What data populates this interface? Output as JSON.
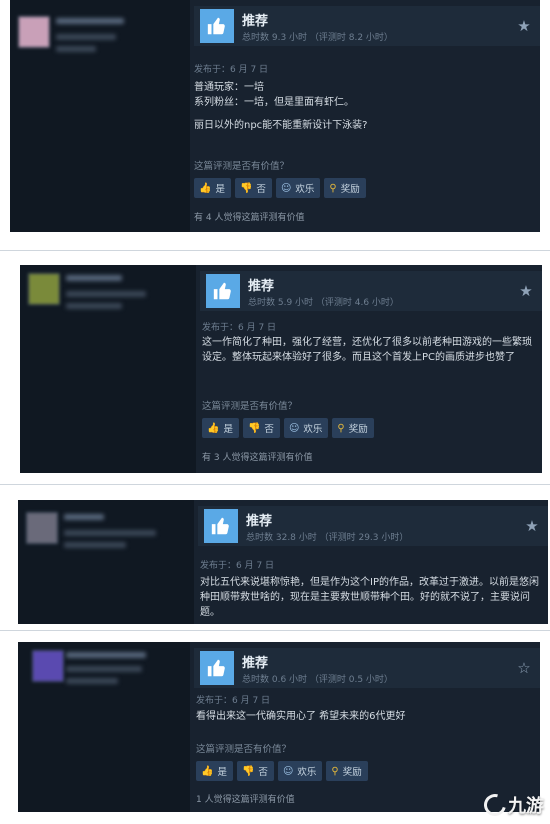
{
  "reviews": [
    {
      "rec": "推荐",
      "hours": "总时数 9.3 小时  （评测时 8.2 小时）",
      "posted": "发布于：6 月 7 日",
      "content": [
        "普通玩家：一培",
        "系列粉丝：一培，但是里面有虾仁。",
        "",
        "丽日以外的npc能不能重新设计下泳装?"
      ],
      "helpful_q": "这篇评测是否有价值？",
      "btn_yes": "是",
      "btn_no": "否",
      "btn_funny": "欢乐",
      "btn_award": "奖励",
      "found": "有 4 人觉得这篇评测有价值",
      "avatar_color": "#c9a0b8"
    },
    {
      "rec": "推荐",
      "hours": "总时数 5.9 小时  （评测时 4.6 小时）",
      "posted": "发布于：6 月 7 日",
      "content": [
        "这一作简化了种田，强化了经营，还优化了很多以前老种田游戏的一些繁琐设定。整体玩起来体验好了很多。而且这个首发上PC的画质进步也赞了"
      ],
      "helpful_q": "这篇评测是否有价值？",
      "btn_yes": "是",
      "btn_no": "否",
      "btn_funny": "欢乐",
      "btn_award": "奖励",
      "found": "有 3 人觉得这篇评测有价值",
      "avatar_color": "#7a8a3a"
    },
    {
      "rec": "推荐",
      "hours": "总时数 32.8 小时  （评测时 29.3 小时）",
      "posted": "发布于：6 月 7 日",
      "content": [
        "对比五代来说堪称惊艳，但是作为这个IP的作品，改革过于激进。以前是悠闲种田顺带救世啥的，现在是主要救世顺带种个田。好的就不说了，主要说问题。"
      ],
      "avatar_color": "#6a6a7a"
    },
    {
      "rec": "推荐",
      "hours": "总时数 0.6 小时  （评测时 0.5 小时）",
      "posted": "发布于：6 月 7 日",
      "content": [
        "看得出来这一代确实用心了 希望未来的6代更好"
      ],
      "helpful_q": "这篇评测是否有价值？",
      "btn_yes": "是",
      "btn_no": "否",
      "btn_funny": "欢乐",
      "btn_award": "奖励",
      "found": "1 人觉得这篇评测有价值",
      "avatar_color": "#5a4ab0"
    }
  ],
  "watermark": "九游",
  "colors": {
    "page_bg": "#16202d",
    "thumb": "#5aa9e6",
    "button": "#2a3f5a"
  }
}
